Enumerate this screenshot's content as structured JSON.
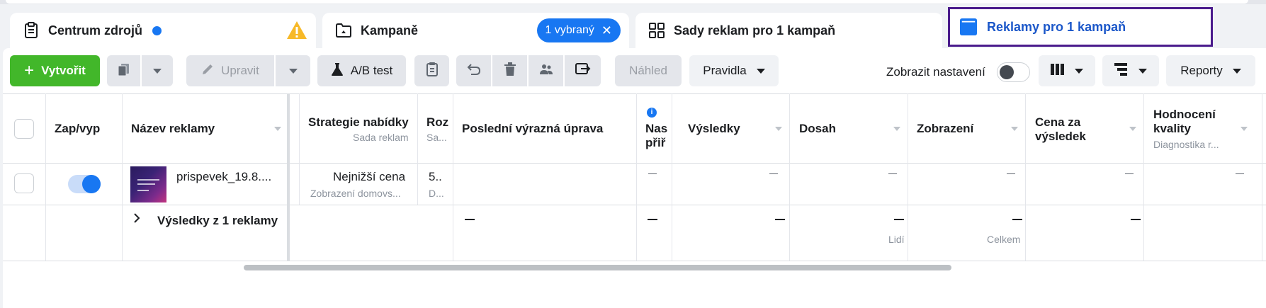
{
  "tabs": [
    {
      "label": "Centrum zdrojů",
      "icon": "clipboard-icon"
    },
    {
      "label": "Kampaně",
      "icon": "folder-icon",
      "chip": "1 vybraný"
    },
    {
      "label": "Sady reklam pro 1 kampaň",
      "icon": "grid-icon"
    },
    {
      "label": "Reklamy pro 1 kampaň",
      "icon": "ad-window-icon"
    }
  ],
  "toolbar": {
    "create": "Vytvořit",
    "edit": "Upravit",
    "ab_test": "A/B test",
    "preview": "Náhled",
    "rules": "Pravidla",
    "show_settings": "Zobrazit nastavení",
    "reports": "Reporty"
  },
  "columns": {
    "onoff": "Zap/vyp",
    "ad_name": "Název reklamy",
    "bid_strategy": "Strategie nabídky",
    "bid_strategy_sub": "Sada reklam",
    "budget": "Roz",
    "budget_sub": "Sa...",
    "last_edit": "Poslední výrazná úprava",
    "attr": "Nas",
    "attr2": "přiř",
    "results": "Výsledky",
    "reach": "Dosah",
    "impressions": "Zobrazení",
    "cost_per_result": "Cena za",
    "cost_per_result2": "výsledek",
    "quality": "Hodnocení",
    "quality2": "kvality",
    "quality_sub": "Diagnostika r..."
  },
  "row": {
    "ad_name": "prispevek_19.8....",
    "bid_strategy": "Nejnižší cena",
    "bid_strategy_sub": "Zobrazení domovs...",
    "budget": "5..",
    "budget_sub": "D...",
    "dash": "—"
  },
  "summary": {
    "label": "Výsledky z 1 reklamy",
    "reach_sub": "Lidí",
    "impressions_sub": "Celkem"
  },
  "colors": {
    "accent": "#1877f2",
    "create_green": "#42b72a",
    "active_tab_border": "#4a1b8c",
    "active_tab_text": "#1b57c9",
    "warning": "#f7b928"
  }
}
